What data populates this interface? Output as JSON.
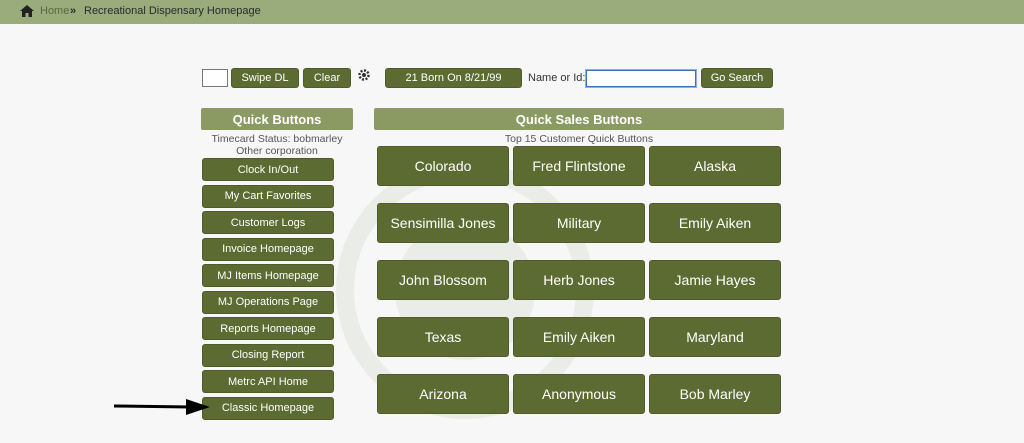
{
  "breadcrumb": {
    "home": "Home",
    "separator": "»",
    "current": "Recreational Dispensary Homepage"
  },
  "toolbar": {
    "swipe_label": "Swipe DL",
    "clear_label": "Clear",
    "born_label": "21 Born On 8/21/99",
    "search_label": "Name or Id:",
    "search_value": "",
    "go_label": "Go Search"
  },
  "quick_buttons": {
    "title": "Quick Buttons",
    "timecard": "Timecard Status: bobmarley",
    "corporation": "Other corporation",
    "items": [
      "Clock In/Out",
      "My Cart Favorites",
      "Customer Logs",
      "Invoice Homepage",
      "MJ Items Homepage",
      "MJ Operations Page",
      "Reports Homepage",
      "Closing Report",
      "Metrc API Home",
      "Classic Homepage"
    ]
  },
  "quick_sales": {
    "title": "Quick Sales Buttons",
    "subtitle": "Top 15 Customer Quick Buttons",
    "items": [
      "Colorado",
      "Fred Flintstone",
      "Alaska",
      "Sensimilla Jones",
      "Military",
      "Emily Aiken",
      "John Blossom",
      "Herb Jones",
      "Jamie Hayes",
      "Texas",
      "Emily Aiken",
      "Maryland",
      "Arizona",
      "Anonymous",
      "Bob Marley"
    ]
  },
  "colors": {
    "topbar": "#9aab7c",
    "button": "#5c6b32",
    "header": "#8a9a62"
  },
  "icons": [
    "home-icon",
    "gear-icon",
    "arrow-annotation"
  ]
}
